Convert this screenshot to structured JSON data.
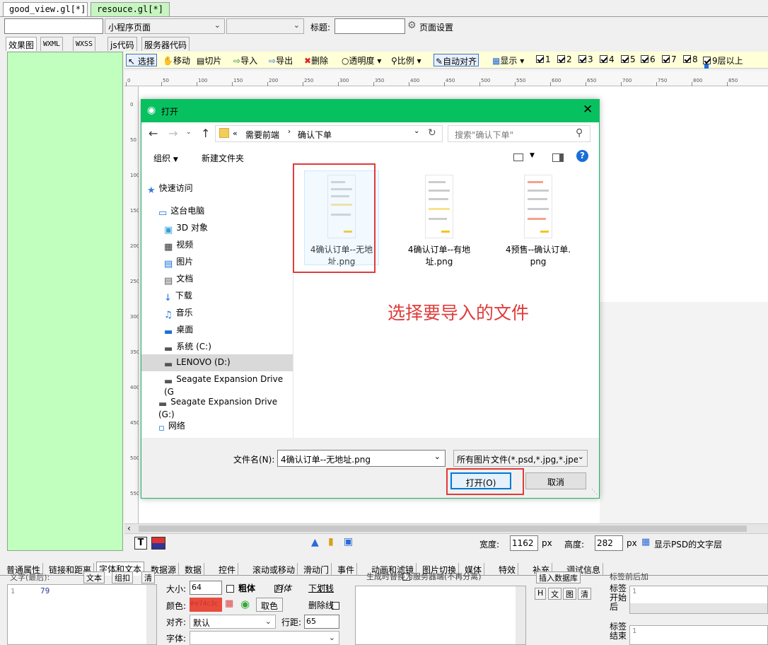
{
  "doc_tabs": [
    "good_view.gl[*]",
    "resouce.gl[*]"
  ],
  "top_bar": {
    "page_type": "小程序页面",
    "title_label": "标题:",
    "title_value": "",
    "page_settings": "页面设置"
  },
  "view_tabs": [
    "效果图",
    "WXML",
    "WXSS",
    "js代码",
    "服务器代码"
  ],
  "toolbar": {
    "select": "选择",
    "move": "移动",
    "slice": "切片",
    "import": "导入",
    "export": "导出",
    "delete": "删除",
    "opacity": "透明度",
    "scale": "比例",
    "auto_align": "自动对齐",
    "display": "显示",
    "layers": [
      "1",
      "2",
      "3",
      "4",
      "5",
      "6",
      "7",
      "8",
      "9层以上"
    ]
  },
  "ruler_top": [
    "0",
    "50",
    "100",
    "150",
    "200",
    "250",
    "300",
    "350",
    "400",
    "450",
    "500",
    "550",
    "600",
    "650",
    "700",
    "750",
    "800",
    "850"
  ],
  "ruler_left": [
    "0",
    "50",
    "100",
    "150",
    "200",
    "250",
    "300",
    "350",
    "400",
    "450",
    "500",
    "550"
  ],
  "status": {
    "width_label": "宽度:",
    "width_value": "1162",
    "height_label": "高度:",
    "height_value": "282",
    "unit": "px",
    "show_psd": "显示PSD的文字层"
  },
  "prop_tabs": [
    "普通属性",
    "链接和距离",
    "字体和文本",
    "数据源",
    "数据",
    "控件",
    "滚动或移动",
    "滑动门",
    "事件",
    "动画和滤镜",
    "图片切换",
    "媒体",
    "特效",
    "补充",
    "调试信息"
  ],
  "props": {
    "text_label": "文字(最后):",
    "text_btn": "文本",
    "mark_btn": "组扣",
    "clear_btn": "清",
    "code_line": "1",
    "code_value": "79",
    "size_label": "大小:",
    "size_value": "64",
    "bold": "粗体",
    "italic": "斜体",
    "underline": "下划线",
    "color_label": "颜色:",
    "color_value": "#e74c3c",
    "pick": "取色",
    "strike": "删除线",
    "align_label": "对齐:",
    "align_value": "默认",
    "line_label": "行距:",
    "line_value": "65",
    "font_label": "字体:",
    "server_note": "生成时替换为服务器端(不再分离)",
    "insert_db": "插入数据库",
    "mini_btns": [
      "H",
      "文",
      "图",
      "清"
    ],
    "tag_start": "标签开始后",
    "tag_end": "标签结束",
    "tag_title": "标签前后加",
    "line1": "1"
  },
  "dialog": {
    "title": "打开",
    "path": [
      "需要前端",
      "确认下单"
    ],
    "search_placeholder": "搜索\"确认下单\"",
    "organize": "组织",
    "new_folder": "新建文件夹",
    "nav": [
      {
        "label": "快速访问",
        "icon": "star-icon"
      },
      {
        "label": "这台电脑",
        "icon": "computer-icon"
      },
      {
        "label": "3D 对象",
        "icon": "cube-icon"
      },
      {
        "label": "视频",
        "icon": "film-icon"
      },
      {
        "label": "图片",
        "icon": "picture-icon"
      },
      {
        "label": "文档",
        "icon": "document-icon"
      },
      {
        "label": "下载",
        "icon": "download-icon"
      },
      {
        "label": "音乐",
        "icon": "music-icon"
      },
      {
        "label": "桌面",
        "icon": "desktop-icon"
      },
      {
        "label": "系统 (C:)",
        "icon": "drive-icon"
      },
      {
        "label": "LENOVO (D:)",
        "icon": "drive-icon"
      },
      {
        "label": "Seagate Expansion Drive (G",
        "icon": "drive-icon"
      },
      {
        "label": "Seagate Expansion Drive (G:)",
        "icon": "drive-icon"
      },
      {
        "label": "网络",
        "icon": "network-icon"
      }
    ],
    "files": [
      {
        "line1": "4确认订单--无地",
        "line2": "址.png"
      },
      {
        "line1": "4确认订单--有地",
        "line2": "址.png"
      },
      {
        "line1": "4预售--确认订单.",
        "line2": "png"
      }
    ],
    "annotation": "选择要导入的文件",
    "filename_label": "文件名(N):",
    "filename_value": "4确认订单--无地址.png",
    "filetype": "所有图片文件(*.psd,*.jpg,*.jpe",
    "open_btn": "打开(O)",
    "cancel_btn": "取消"
  }
}
